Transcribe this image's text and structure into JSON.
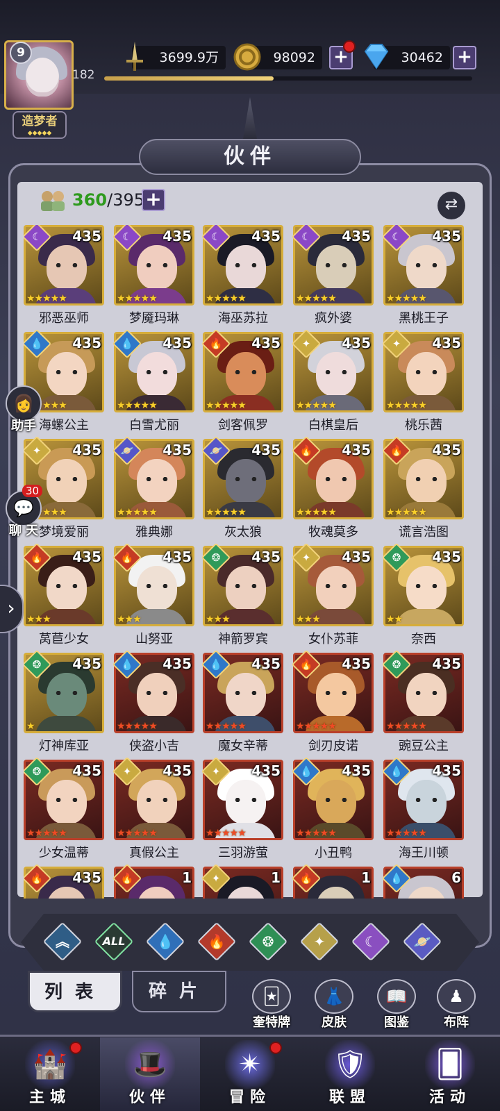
{
  "player": {
    "level": "9",
    "level_num": "182",
    "rank": "造梦者",
    "rank_stars": "◆◆◆◆◆",
    "xp_fraction": 0.46
  },
  "resources": {
    "power": "3699.9万",
    "gold": "98092",
    "diamonds": "30462"
  },
  "title": "伙伴",
  "partner_count": {
    "current": "360",
    "max": "395"
  },
  "partners": [
    {
      "name": "邪恶巫师",
      "level": "435",
      "element": "moon",
      "rarity": "gold",
      "stars": 5
    },
    {
      "name": "梦魇玛琳",
      "level": "435",
      "element": "moon",
      "rarity": "gold",
      "stars": 5
    },
    {
      "name": "海巫苏拉",
      "level": "435",
      "element": "moon",
      "rarity": "gold",
      "stars": 5
    },
    {
      "name": "疯外婆",
      "level": "435",
      "element": "moon",
      "rarity": "gold",
      "stars": 5
    },
    {
      "name": "黑桃王子",
      "level": "435",
      "element": "moon",
      "rarity": "gold",
      "stars": 5
    },
    {
      "name": "海螺公主",
      "level": "435",
      "element": "water",
      "rarity": "gold",
      "stars": 5
    },
    {
      "name": "白雪尤丽",
      "level": "435",
      "element": "water",
      "rarity": "gold",
      "stars": 5
    },
    {
      "name": "剑客佩罗",
      "level": "435",
      "element": "fire",
      "rarity": "gold",
      "stars": 5
    },
    {
      "name": "白棋皇后",
      "level": "435",
      "element": "light",
      "rarity": "gold",
      "stars": 5
    },
    {
      "name": "桃乐茜",
      "level": "435",
      "element": "light",
      "rarity": "gold",
      "stars": 5
    },
    {
      "name": "梦境爱丽",
      "level": "435",
      "element": "light",
      "rarity": "gold",
      "stars": 5
    },
    {
      "name": "雅典娜",
      "level": "435",
      "element": "planet",
      "rarity": "gold",
      "stars": 5
    },
    {
      "name": "灰太狼",
      "level": "435",
      "element": "planet",
      "rarity": "gold",
      "stars": 5
    },
    {
      "name": "牧魂莫多",
      "level": "435",
      "element": "fire",
      "rarity": "gold",
      "stars": 5
    },
    {
      "name": "谎言浩图",
      "level": "435",
      "element": "fire",
      "rarity": "gold",
      "stars": 5
    },
    {
      "name": "莴苣少女",
      "level": "435",
      "element": "fire",
      "rarity": "gold",
      "stars": 3
    },
    {
      "name": "山努亚",
      "level": "435",
      "element": "fire",
      "rarity": "gold",
      "stars": 3
    },
    {
      "name": "神箭罗宾",
      "level": "435",
      "element": "wind",
      "rarity": "gold",
      "stars": 3
    },
    {
      "name": "女仆苏菲",
      "level": "435",
      "element": "light",
      "rarity": "gold",
      "stars": 3
    },
    {
      "name": "奈西",
      "level": "435",
      "element": "wind",
      "rarity": "gold",
      "stars": 2
    },
    {
      "name": "灯神库亚",
      "level": "435",
      "element": "wind",
      "rarity": "gold",
      "stars": 1
    },
    {
      "name": "侠盗小吉",
      "level": "435",
      "element": "water",
      "rarity": "red",
      "stars": 5
    },
    {
      "name": "魔女辛蒂",
      "level": "435",
      "element": "water",
      "rarity": "red",
      "stars": 5
    },
    {
      "name": "剑刃皮诺",
      "level": "435",
      "element": "fire",
      "rarity": "red",
      "stars": 5
    },
    {
      "name": "豌豆公主",
      "level": "435",
      "element": "wind",
      "rarity": "red",
      "stars": 5
    },
    {
      "name": "少女温蒂",
      "level": "435",
      "element": "wind",
      "rarity": "red",
      "stars": 5
    },
    {
      "name": "真假公主",
      "level": "435",
      "element": "light",
      "rarity": "red",
      "stars": 5
    },
    {
      "name": "三羽游萤",
      "level": "435",
      "element": "light",
      "rarity": "red",
      "stars": 5
    },
    {
      "name": "小丑鸭",
      "level": "435",
      "element": "water",
      "rarity": "red",
      "stars": 5
    },
    {
      "name": "海王川顿",
      "level": "435",
      "element": "water",
      "rarity": "red",
      "stars": 5
    }
  ],
  "partial_row_levels": [
    "435",
    "1",
    "1",
    "1",
    "6"
  ],
  "side": {
    "helper": "助手",
    "chat": "聊 天",
    "chat_badge": "30"
  },
  "filters": [
    {
      "name": "arrow",
      "symbol": "︽",
      "color": "#2f5d86"
    },
    {
      "name": "all",
      "symbol": "ALL",
      "color": "#2a3a33"
    },
    {
      "name": "water",
      "symbol": "💧",
      "color": "#2f6fb8"
    },
    {
      "name": "fire",
      "symbol": "🔥",
      "color": "#b33a2b"
    },
    {
      "name": "wind",
      "symbol": "❂",
      "color": "#2e8f55"
    },
    {
      "name": "light",
      "symbol": "✦",
      "color": "#b6a04a"
    },
    {
      "name": "moon",
      "symbol": "☾",
      "color": "#8a4fc0"
    },
    {
      "name": "planet",
      "symbol": "🪐",
      "color": "#5a5bc2"
    }
  ],
  "subtabs": {
    "list": "列表",
    "fragments": "碎片"
  },
  "tools": [
    {
      "label": "奎特牌",
      "icon": "🃏"
    },
    {
      "label": "皮肤",
      "icon": "👗"
    },
    {
      "label": "图鉴",
      "icon": "📖"
    },
    {
      "label": "布阵",
      "icon": "♟"
    }
  ],
  "nav": [
    {
      "label": "主城",
      "icon": "🏰",
      "dot": true
    },
    {
      "label": "伙伴",
      "icon": "🎩",
      "dot": false
    },
    {
      "label": "冒险",
      "icon": "✴",
      "dot": true
    },
    {
      "label": "联盟",
      "icon": "🛡",
      "dot": false
    },
    {
      "label": "活动",
      "icon": "🂠",
      "dot": false
    }
  ],
  "colors": {
    "moon": "#8b48c6",
    "water": "#2f78c9",
    "fire": "#c53b24",
    "light": "#c9aa40",
    "planet": "#5656c8",
    "wind": "#2f9a5a",
    "gold_frame": "#d6ad3a",
    "red_frame": "#b9402a"
  }
}
